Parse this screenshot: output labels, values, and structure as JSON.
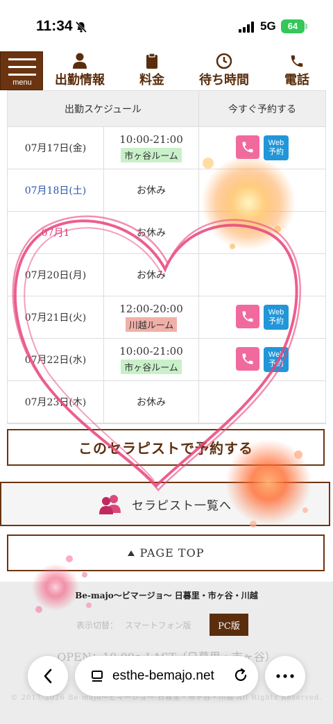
{
  "status_bar": {
    "time": "11:34",
    "network": "5G",
    "battery": "64"
  },
  "nav": {
    "menu_label": "menu",
    "items": [
      {
        "label": "出勤情報",
        "icon": "person-icon"
      },
      {
        "label": "料金",
        "icon": "clipboard-icon"
      },
      {
        "label": "待ち時間",
        "icon": "clock-icon"
      },
      {
        "label": "電話",
        "icon": "phone-icon"
      }
    ]
  },
  "schedule": {
    "headers": [
      "出勤スケジュール",
      "今すぐ予約する"
    ],
    "rows": [
      {
        "date": "07月17日(金)",
        "time": "10:00-21:00",
        "room": "市ヶ谷ルーム",
        "off": "",
        "web": [
          "Web",
          "予約"
        ]
      },
      {
        "date": "07月18日(土)",
        "time": "",
        "room": "",
        "off": "お休み"
      },
      {
        "date": "07月1",
        "time": "",
        "room": "",
        "off": "お休み"
      },
      {
        "date": "07月20日(月)",
        "time": "",
        "room": "",
        "off": "お休み"
      },
      {
        "date": "07月21日(火)",
        "time": "12:00-20:00",
        "room": "川越ルーム",
        "off": "",
        "web": [
          "Web",
          "予約"
        ]
      },
      {
        "date": "07月22日(水)",
        "time": "10:00-21:00",
        "room": "市ヶ谷ルーム",
        "off": "",
        "web": [
          "Web",
          "予約"
        ]
      },
      {
        "date": "07月23日(木)",
        "time": "",
        "room": "",
        "off": "お休み"
      }
    ]
  },
  "buttons": {
    "reserve": "このセラピストで予約する",
    "therapists": "セラピスト一覧へ",
    "page_top": "PAGE TOP"
  },
  "footer": {
    "site_name": "Be-majo～ビマージョ～ 日暮里・市ヶ谷・川越",
    "view_label": "表示切替：",
    "smartphone": "スマートフォン版",
    "pc": "PC版",
    "open": "OPEN：10:00～LAST（日暮里・市ヶ谷）",
    "copyright": "© 2017-2026 Be-majo～ビマージョ～ 日暮里・市ヶ谷・川越 All Rights Reserved."
  },
  "browser": {
    "url": "esthe-bemajo.net"
  },
  "colors": {
    "brand_brown": "#6b3410",
    "phone_pink": "#f06a9e",
    "web_blue": "#2196d9",
    "heart_pink": "#e8447a"
  }
}
